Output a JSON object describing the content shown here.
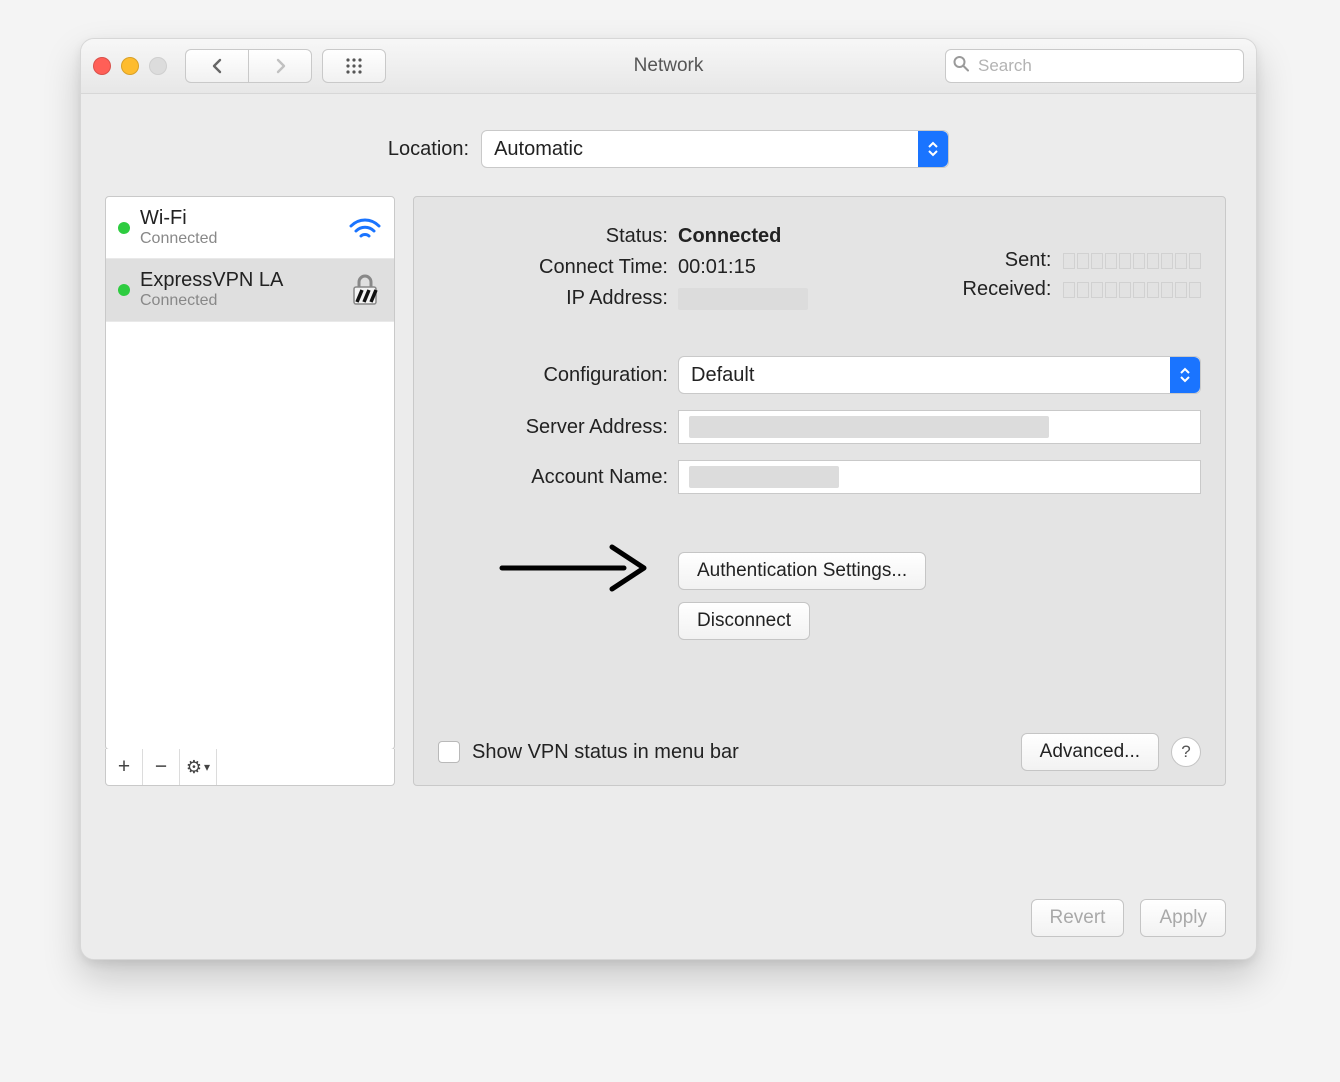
{
  "window": {
    "title": "Network"
  },
  "search": {
    "placeholder": "Search"
  },
  "location": {
    "label": "Location:",
    "value": "Automatic"
  },
  "services": [
    {
      "name": "Wi-Fi",
      "status": "Connected",
      "dot": "green",
      "icon": "wifi",
      "selected": false
    },
    {
      "name": "ExpressVPN LA",
      "status": "Connected",
      "dot": "green",
      "icon": "vpn",
      "selected": true
    }
  ],
  "sidebar_footer": {
    "add": "+",
    "remove": "−",
    "gear": "⚙︎",
    "gear_chevron": "▾"
  },
  "details": {
    "status_label": "Status:",
    "status_value": "Connected",
    "connect_time_label": "Connect Time:",
    "connect_time_value": "00:01:15",
    "ip_label": "IP Address:",
    "sent_label": "Sent:",
    "recv_label": "Received:",
    "configuration_label": "Configuration:",
    "configuration_value": "Default",
    "server_label": "Server Address:",
    "account_label": "Account Name:",
    "auth_settings_btn": "Authentication Settings...",
    "disconnect_btn": "Disconnect",
    "show_vpn_label": "Show VPN status in menu bar",
    "advanced_btn": "Advanced...",
    "help": "?"
  },
  "bottom": {
    "revert": "Revert",
    "apply": "Apply"
  }
}
